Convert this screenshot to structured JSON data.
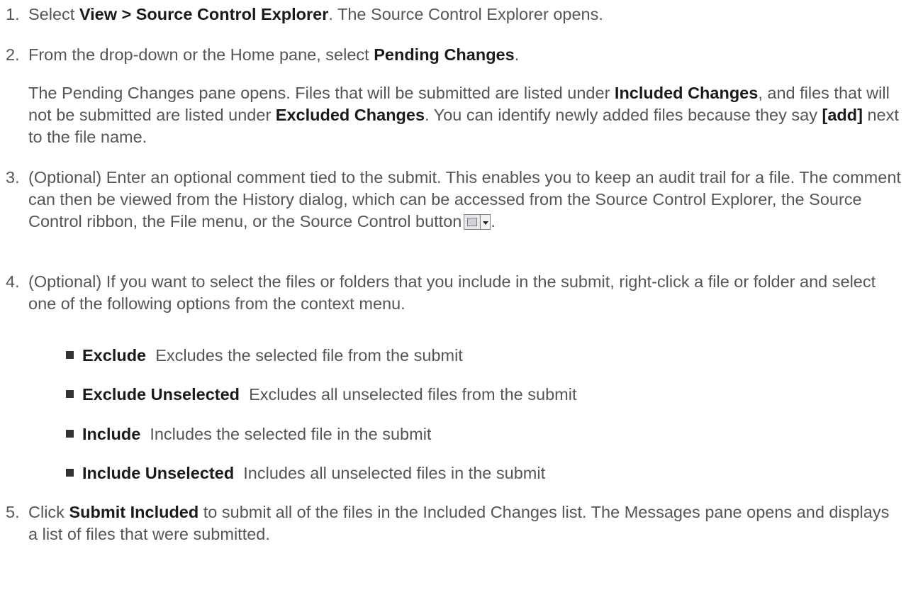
{
  "steps": [
    {
      "num": "1.",
      "pre": "Select ",
      "bold": "View > Source Control Explorer",
      "post": ". The Source Control Explorer opens."
    },
    {
      "num": "2.",
      "pre": "From the drop-down or the Home pane, select ",
      "bold": "Pending Changes",
      "post": "."
    },
    {
      "num": "3.",
      "text": "(Optional) Enter an optional comment tied to the submit. This enables you to keep an audit trail for a file. The comment can then be viewed from the History dialog, which can be accessed from the Source Control Explorer, the Source Control ribbon, the File menu, or the Source Control button",
      "tail": "."
    },
    {
      "num": "4.",
      "text": "(Optional) If you want to select the files or folders that you include in the submit, right-click a file or folder and select one of the following options from the context menu."
    },
    {
      "num": "5.",
      "pre": "Click ",
      "bold": "Submit Included",
      "post": " to submit all of the files in the Included Changes list. The Messages pane opens and displays a list of files that were submitted."
    }
  ],
  "step2_para": {
    "a": "The Pending Changes pane opens. Files that will be submitted are listed under ",
    "b1": "Included Changes",
    "c": ", and files that will not be submitted are listed under ",
    "b2": "Excluded Changes",
    "d": ". You can identify newly added files because they say ",
    "b3": "[add]",
    "e": " next to the file name."
  },
  "options": [
    {
      "name": "Exclude",
      "desc": "Excludes the selected file from the submit"
    },
    {
      "name": "Exclude Unselected",
      "desc": "Excludes all unselected files from the submit"
    },
    {
      "name": "Include",
      "desc": "Includes the selected file in the submit"
    },
    {
      "name": "Include Unselected",
      "desc": "Includes all unselected files in the submit"
    }
  ],
  "icons": {
    "source_control_button": "source-control-button-icon"
  }
}
